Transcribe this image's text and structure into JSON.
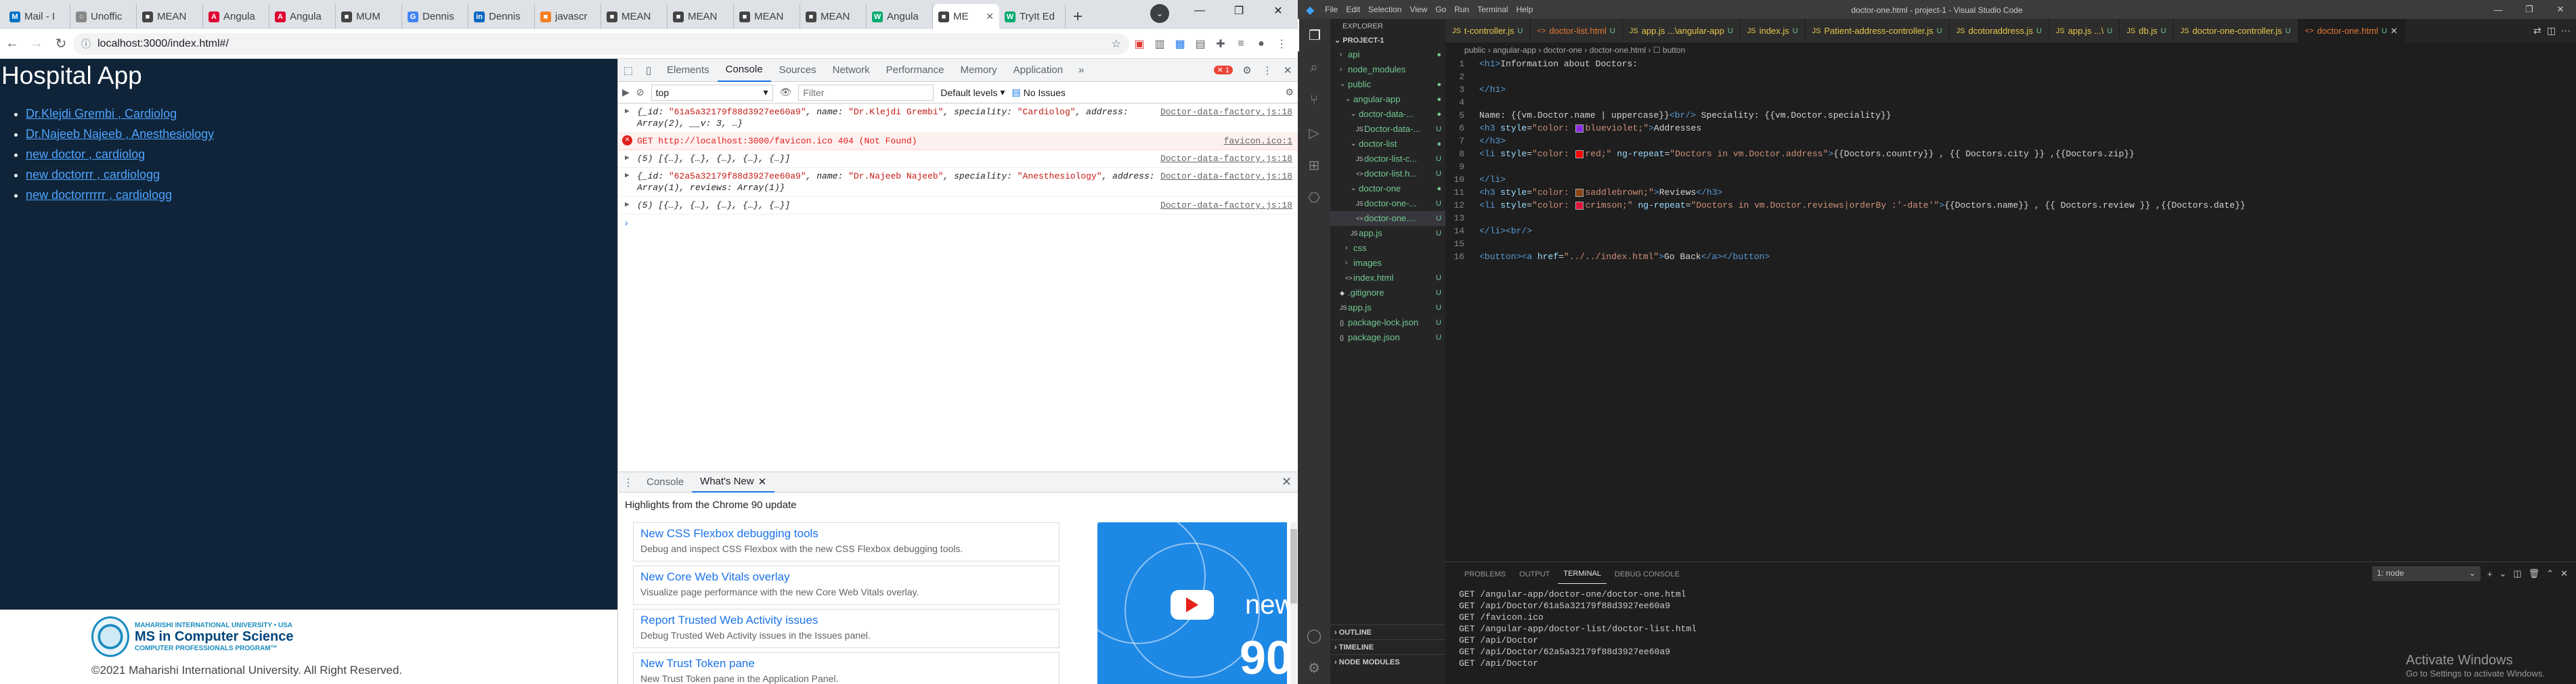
{
  "browser": {
    "tabs": [
      {
        "label": "Mail - I",
        "fav": "M",
        "color": "#0072c6"
      },
      {
        "label": "Unoffic",
        "fav": "○",
        "color": "#888"
      },
      {
        "label": "MEAN",
        "fav": "■",
        "color": "#444"
      },
      {
        "label": "Angula",
        "fav": "A",
        "color": "#dd0031"
      },
      {
        "label": "Angula",
        "fav": "A",
        "color": "#dd0031"
      },
      {
        "label": "MUM",
        "fav": "■",
        "color": "#444"
      },
      {
        "label": "Dennis",
        "fav": "G",
        "color": "#4285f4"
      },
      {
        "label": "Dennis",
        "fav": "in",
        "color": "#0a66c2"
      },
      {
        "label": "javascr",
        "fav": "■",
        "color": "#f48024"
      },
      {
        "label": "MEAN",
        "fav": "■",
        "color": "#444"
      },
      {
        "label": "MEAN",
        "fav": "■",
        "color": "#444"
      },
      {
        "label": "MEAN",
        "fav": "■",
        "color": "#444"
      },
      {
        "label": "MEAN",
        "fav": "■",
        "color": "#444"
      },
      {
        "label": "Angula",
        "fav": "W",
        "color": "#04aa6d"
      },
      {
        "label": "ME",
        "fav": "■",
        "color": "#444",
        "active": true
      },
      {
        "label": "TryIt Ed",
        "fav": "W",
        "color": "#04aa6d"
      }
    ],
    "url": "localhost:3000/index.html#/"
  },
  "app": {
    "title": "Hospital App",
    "doctors": [
      "Dr.Klejdi Grembi , Cardiolog",
      "Dr.Najeeb Najeeb , Anesthesiology",
      "new doctor , cardiolog",
      "new doctorrr , cardiologg",
      "new doctorrrrrr , cardiologg"
    ],
    "footer": {
      "logo_line1": "MAHARISHI INTERNATIONAL UNIVERSITY • USA",
      "logo_line2": "MS in Computer Science",
      "logo_line3": "COMPUTER PROFESSIONALS PROGRAM™",
      "copyright": "©2021 Maharishi International University. All Right Reserved."
    }
  },
  "devtools": {
    "tabs": [
      "Elements",
      "Console",
      "Sources",
      "Network",
      "Performance",
      "Memory",
      "Application"
    ],
    "error_count": "1",
    "context": "top",
    "filter_placeholder": "Filter",
    "levels": "Default levels",
    "no_issues": "No Issues",
    "console": [
      {
        "kind": "obj",
        "text_parts": [
          {
            "t": "{_id: ",
            "c": ""
          },
          {
            "t": "\"61a5a32179f88d3927ee60a9\"",
            "c": "s"
          },
          {
            "t": ", name: ",
            "c": ""
          },
          {
            "t": "\"Dr.Klejdi Grembi\"",
            "c": "s"
          },
          {
            "t": ", speciality: ",
            "c": ""
          },
          {
            "t": "\"Cardiolog\"",
            "c": "s"
          },
          {
            "t": ", address: Array(2), __v: 3, …}",
            "c": ""
          }
        ],
        "source": "Doctor-data-factory.js:18"
      },
      {
        "kind": "err",
        "text": "GET http://localhost:3000/favicon.ico 404 (Not Found)",
        "source": "favicon.ico:1"
      },
      {
        "kind": "obj",
        "text_parts": [
          {
            "t": "(5) [{…}, {…}, {…}, {…}, {…}]",
            "c": ""
          }
        ],
        "source": "Doctor-data-factory.js:18"
      },
      {
        "kind": "obj",
        "text_parts": [
          {
            "t": "{_id: ",
            "c": ""
          },
          {
            "t": "\"62a5a32179f88d3927ee60a9\"",
            "c": "s"
          },
          {
            "t": ", name: ",
            "c": ""
          },
          {
            "t": "\"Dr.Najeeb Najeeb\"",
            "c": "s"
          },
          {
            "t": ", speciality: ",
            "c": ""
          },
          {
            "t": "\"Anesthesiology\"",
            "c": "s"
          },
          {
            "t": ", address: Array(1), reviews: Array(1)}",
            "c": ""
          }
        ],
        "source": "Doctor-data-factory.js:18"
      },
      {
        "kind": "obj",
        "text_parts": [
          {
            "t": "(5) [{…}, {…}, {…}, {…}, {…}]",
            "c": ""
          }
        ],
        "source": "Doctor-data-factory.js:18"
      }
    ],
    "drawer_tabs": [
      "Console",
      "What's New"
    ],
    "highlights": "Highlights from the Chrome 90 update",
    "whats_new": [
      {
        "title": "New CSS Flexbox debugging tools",
        "desc": "Debug and inspect CSS Flexbox with the new CSS Flexbox debugging tools."
      },
      {
        "title": "New Core Web Vitals overlay",
        "desc": "Visualize page performance with the new Core Web Vitals overlay."
      },
      {
        "title": "Report Trusted Web Activity issues",
        "desc": "Debug Trusted Web Activity issues in the Issues panel."
      },
      {
        "title": "New Trust Token pane",
        "desc": "New Trust Token pane in the Application Panel."
      }
    ],
    "video_text_new": "new",
    "video_text_num": "90"
  },
  "vscode": {
    "menus": [
      "File",
      "Edit",
      "Selection",
      "View",
      "Go",
      "Run",
      "Terminal",
      "Help"
    ],
    "title": "doctor-one.html - project-1 - Visual Studio Code",
    "explorer_header": "EXPLORER",
    "project": "PROJECT-1",
    "files": [
      {
        "name": "api",
        "indent": 1,
        "type": "dir",
        "open": false,
        "status": "●"
      },
      {
        "name": "node_modules",
        "indent": 1,
        "type": "dir",
        "open": false,
        "status": ""
      },
      {
        "name": "public",
        "indent": 1,
        "type": "dir",
        "open": true,
        "status": "●"
      },
      {
        "name": "angular-app",
        "indent": 2,
        "type": "dir",
        "open": true,
        "status": "●"
      },
      {
        "name": "doctor-data-...",
        "indent": 3,
        "type": "dir",
        "open": true,
        "status": "●"
      },
      {
        "name": "Doctor-data-...",
        "indent": 4,
        "type": "js",
        "status": "U"
      },
      {
        "name": "doctor-list",
        "indent": 3,
        "type": "dir",
        "open": true,
        "status": "●"
      },
      {
        "name": "doctor-list-c...",
        "indent": 4,
        "type": "js",
        "status": "U"
      },
      {
        "name": "doctor-list.h...",
        "indent": 4,
        "type": "html",
        "status": "U"
      },
      {
        "name": "doctor-one",
        "indent": 3,
        "type": "dir",
        "open": true,
        "status": "●"
      },
      {
        "name": "doctor-one-...",
        "indent": 4,
        "type": "js",
        "status": "U"
      },
      {
        "name": "doctor-one....",
        "indent": 4,
        "type": "html",
        "status": "U",
        "selected": true
      },
      {
        "name": "app.js",
        "indent": 3,
        "type": "js",
        "status": "U"
      },
      {
        "name": "css",
        "indent": 2,
        "type": "dir",
        "open": false,
        "status": ""
      },
      {
        "name": "images",
        "indent": 2,
        "type": "dir",
        "open": false,
        "status": ""
      },
      {
        "name": "index.html",
        "indent": 2,
        "type": "html",
        "status": "U"
      },
      {
        "name": ".gitignore",
        "indent": 1,
        "type": "git",
        "status": "U"
      },
      {
        "name": "app.js",
        "indent": 1,
        "type": "js",
        "status": "U"
      },
      {
        "name": "package-lock.json",
        "indent": 1,
        "type": "json",
        "status": "U"
      },
      {
        "name": "package.json",
        "indent": 1,
        "type": "json",
        "status": "U"
      }
    ],
    "outline": [
      "OUTLINE",
      "TIMELINE",
      "NODE MODULES"
    ],
    "editor_tabs": [
      {
        "label": "t-controller.js",
        "type": "js",
        "status": "U"
      },
      {
        "label": "doctor-list.html",
        "type": "html",
        "status": "U"
      },
      {
        "label": "app.js ...\\angular-app",
        "type": "js",
        "status": "U"
      },
      {
        "label": "index.js",
        "type": "js",
        "status": "U"
      },
      {
        "label": "Patient-address-controller.js",
        "type": "js",
        "status": "U"
      },
      {
        "label": "dcotoraddress.js",
        "type": "js",
        "status": "U"
      },
      {
        "label": "app.js ...\\",
        "type": "js",
        "status": "U"
      },
      {
        "label": "db.js",
        "type": "js",
        "status": "U"
      },
      {
        "label": "doctor-one-controller.js",
        "type": "js",
        "status": "U"
      },
      {
        "label": "doctor-one.html",
        "type": "html",
        "status": "U",
        "active": true
      }
    ],
    "breadcrumb": "public › angular-app › doctor-one › doctor-one.html › ☐ button",
    "code": [
      {
        "n": "1",
        "p": [
          {
            "t": "<h1>",
            "c": "tg"
          },
          {
            "t": "Information about Doctors:",
            "c": "tc"
          }
        ]
      },
      {
        "n": "2",
        "p": []
      },
      {
        "n": "3",
        "p": [
          {
            "t": "</h1>",
            "c": "tg"
          }
        ]
      },
      {
        "n": "4",
        "p": []
      },
      {
        "n": "5",
        "p": [
          {
            "t": "Name: {{vm.Doctor.name | uppercase}}",
            "c": "tc"
          },
          {
            "t": "<br/>",
            "c": "tg"
          },
          {
            "t": " Speciality: {{vm.Doctor.speciality}}",
            "c": "tc"
          }
        ]
      },
      {
        "n": "6",
        "p": [
          {
            "t": "<h3 ",
            "c": "tg"
          },
          {
            "t": "style",
            "c": "at"
          },
          {
            "t": "=",
            "c": "tc"
          },
          {
            "t": "\"color: ",
            "c": "av"
          },
          {
            "sw": "#8a2be2"
          },
          {
            "t": "blueviolet;\"",
            "c": "av"
          },
          {
            "t": ">",
            "c": "tg"
          },
          {
            "t": "Addresses",
            "c": "tc"
          }
        ]
      },
      {
        "n": "7",
        "p": [
          {
            "t": "</h3>",
            "c": "tg"
          }
        ]
      },
      {
        "n": "8",
        "p": [
          {
            "t": "<li ",
            "c": "tg"
          },
          {
            "t": "style",
            "c": "at"
          },
          {
            "t": "=",
            "c": "tc"
          },
          {
            "t": "\"color: ",
            "c": "av"
          },
          {
            "sw": "#ff0000"
          },
          {
            "t": "red;\"",
            "c": "av"
          },
          {
            "t": " ng-repeat",
            "c": "at"
          },
          {
            "t": "=",
            "c": "tc"
          },
          {
            "t": "\"Doctors in vm.Doctor.address\"",
            "c": "av"
          },
          {
            "t": ">",
            "c": "tg"
          },
          {
            "t": "{{Doctors.country}} , {{ Doctors.city }} ,{{Doctors.zip}}",
            "c": "tc"
          }
        ]
      },
      {
        "n": "9",
        "p": []
      },
      {
        "n": "10",
        "p": [
          {
            "t": "</li>",
            "c": "tg"
          }
        ]
      },
      {
        "n": "11",
        "p": [
          {
            "t": "<h3 ",
            "c": "tg"
          },
          {
            "t": "style",
            "c": "at"
          },
          {
            "t": "=",
            "c": "tc"
          },
          {
            "t": "\"color: ",
            "c": "av"
          },
          {
            "sw": "#8b4513"
          },
          {
            "t": "saddlebrown;\"",
            "c": "av"
          },
          {
            "t": ">",
            "c": "tg"
          },
          {
            "t": "Reviews",
            "c": "tc"
          },
          {
            "t": "</h3>",
            "c": "tg"
          }
        ]
      },
      {
        "n": "12",
        "p": [
          {
            "t": "<li ",
            "c": "tg"
          },
          {
            "t": "style",
            "c": "at"
          },
          {
            "t": "=",
            "c": "tc"
          },
          {
            "t": "\"color: ",
            "c": "av"
          },
          {
            "sw": "#dc143c"
          },
          {
            "t": "crimson;\"",
            "c": "av"
          },
          {
            "t": " ng-repeat",
            "c": "at"
          },
          {
            "t": "=",
            "c": "tc"
          },
          {
            "t": "\"Doctors in vm.Doctor.reviews|orderBy :'-date'\"",
            "c": "av"
          },
          {
            "t": ">",
            "c": "tg"
          },
          {
            "t": "{{Doctors.name}} , {{ Doctors.review }} ,{{Doctors.date}}",
            "c": "tc"
          }
        ]
      },
      {
        "n": "13",
        "p": []
      },
      {
        "n": "14",
        "p": [
          {
            "t": "</li>",
            "c": "tg"
          },
          {
            "t": "<br/>",
            "c": "tg"
          }
        ]
      },
      {
        "n": "15",
        "p": []
      },
      {
        "n": "16",
        "p": [
          {
            "t": "<button>",
            "c": "tg"
          },
          {
            "t": "<a ",
            "c": "tg"
          },
          {
            "t": "href",
            "c": "at"
          },
          {
            "t": "=",
            "c": "tc"
          },
          {
            "t": "\"../../index.html\"",
            "c": "av"
          },
          {
            "t": ">",
            "c": "tg"
          },
          {
            "t": "Go Back",
            "c": "tc"
          },
          {
            "t": "</a>",
            "c": "tg"
          },
          {
            "t": "</button>",
            "c": "tg"
          }
        ]
      }
    ],
    "panel_tabs": [
      "PROBLEMS",
      "OUTPUT",
      "TERMINAL",
      "DEBUG CONSOLE"
    ],
    "terminal_select": "1: node",
    "terminal": [
      "GET /angular-app/doctor-one/doctor-one.html",
      "GET /api/Doctor/61a5a32179f88d3927ee60a9",
      "GET /favicon.ico",
      "GET /angular-app/doctor-list/doctor-list.html",
      "GET /api/Doctor",
      "GET /api/Doctor/62a5a32179f88d3927ee60a9",
      "GET /api/Doctor"
    ],
    "activate_title": "Activate Windows",
    "activate_sub": "Go to Settings to activate Windows."
  }
}
